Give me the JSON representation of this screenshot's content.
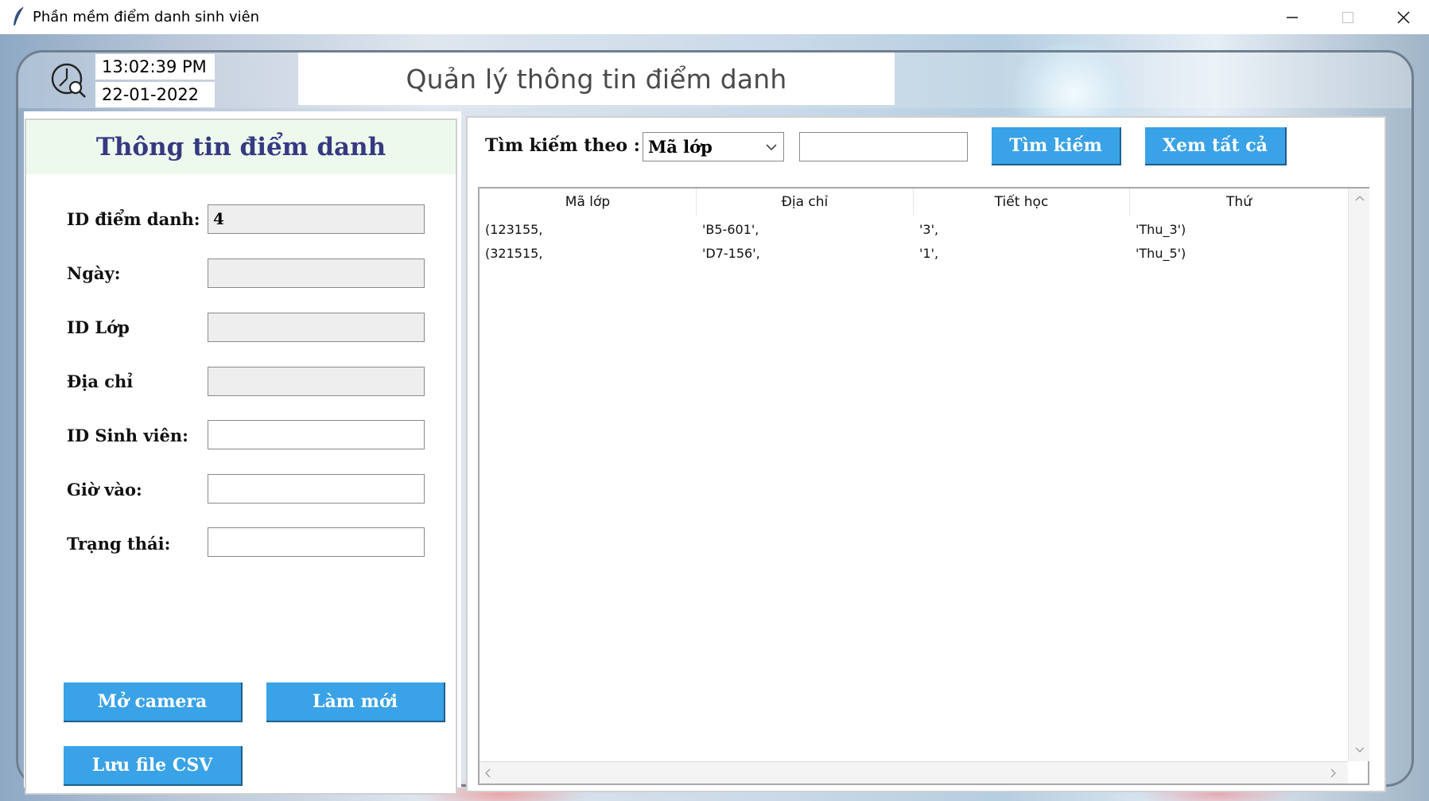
{
  "window": {
    "title": "Phần mềm điểm danh sinh viên",
    "minimize_icon": "minimize-icon",
    "maximize_icon": "maximize-icon",
    "close_icon": "close-icon"
  },
  "header": {
    "time": "13:02:39 PM",
    "date": "22-01-2022",
    "title": "Quản lý thông tin điểm danh"
  },
  "left_panel": {
    "heading": "Thông tin điểm danh",
    "fields": [
      {
        "label": "ID điểm danh:",
        "value": "4"
      },
      {
        "label": "Ngày:",
        "value": ""
      },
      {
        "label": "ID Lớp",
        "value": ""
      },
      {
        "label": "Địa chỉ",
        "value": ""
      },
      {
        "label": "ID Sinh viên:",
        "value": ""
      },
      {
        "label": "Giờ vào:",
        "value": ""
      },
      {
        "label": "Trạng thái:",
        "value": ""
      }
    ],
    "buttons": {
      "open_camera": "Mở camera",
      "refresh": "Làm mới",
      "save_csv": "Lưu file CSV"
    }
  },
  "search": {
    "label": "Tìm kiếm theo :",
    "selected": "Mã lớp",
    "query": "",
    "search_button": "Tìm kiếm",
    "view_all_button": "Xem tất cả"
  },
  "table": {
    "columns": [
      "Mã lớp",
      "Địa chỉ",
      "Tiết học",
      "Thứ"
    ],
    "rows": [
      [
        "(123155,",
        "'B5-601',",
        "'3',",
        "'Thu_3')"
      ],
      [
        "(321515,",
        "'D7-156',",
        "'1',",
        "'Thu_5')"
      ]
    ]
  },
  "colors": {
    "button_blue": "#3aa2e6",
    "heading_navy": "#353a80",
    "heading_bg": "#eef9ee"
  }
}
